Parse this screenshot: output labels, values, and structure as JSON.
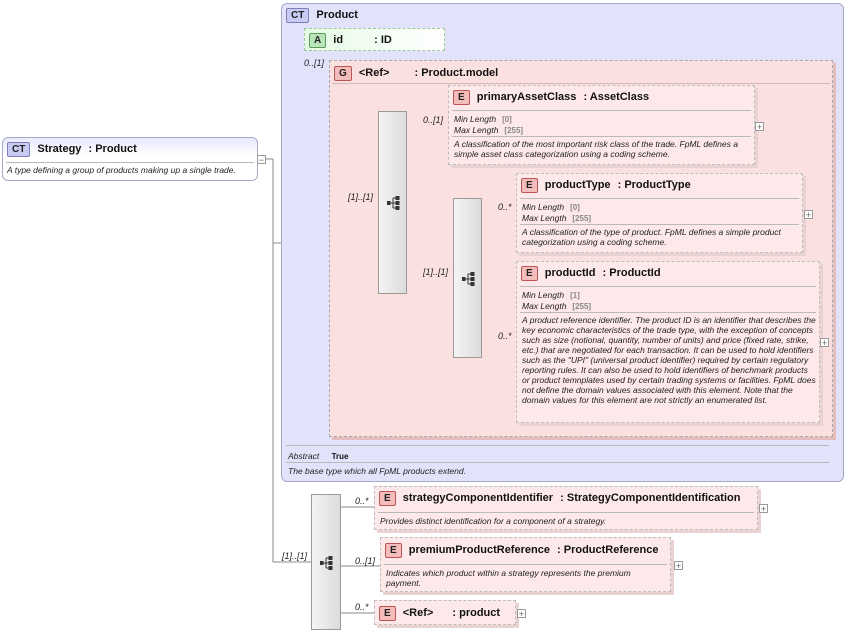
{
  "strategy": {
    "badge": "CT",
    "name": "Strategy",
    "type": ": Product",
    "doc": "A type defining a group of products making up a single trade."
  },
  "product": {
    "badge": "CT",
    "name": "Product",
    "abstract_label": "Abstract",
    "abstract_value": "True",
    "doc": "The base type which all FpML products extend.",
    "id_attr": {
      "badge": "A",
      "name": "id",
      "type": ": ID"
    },
    "id_cardinality": "0..[1]",
    "group": {
      "badge": "G",
      "name": "<Ref>",
      "type": ": Product.model",
      "seq_cardinality": "[1]..[1]"
    }
  },
  "primaryAssetClass": {
    "badge": "E",
    "name": "primaryAssetClass",
    "type": ": AssetClass",
    "cardinality": "0..[1]",
    "facets": [
      {
        "label": "Min Length",
        "value": "[0]"
      },
      {
        "label": "Max Length",
        "value": "[255]"
      }
    ],
    "doc": "A classification of the most important risk class of the trade. FpML defines a simple asset class categorization using a coding scheme."
  },
  "inner_seq_cardinality": "[1]..[1]",
  "productType": {
    "badge": "E",
    "name": "productType",
    "type": ": ProductType",
    "cardinality": "0..*",
    "facets": [
      {
        "label": "Min Length",
        "value": "[0]"
      },
      {
        "label": "Max Length",
        "value": "[255]"
      }
    ],
    "doc": "A classification of the type of product. FpML defines a simple product categorization using a coding scheme."
  },
  "productId": {
    "badge": "E",
    "name": "productId",
    "type": ": ProductId",
    "cardinality": "0..*",
    "facets": [
      {
        "label": "Min Length",
        "value": "[1]"
      },
      {
        "label": "Max Length",
        "value": "[255]"
      }
    ],
    "doc": "A product reference identifier. The product ID is an identifier that describes the key economic characteristics of the trade type, with the exception of concepts such as size (notional, quantity, number of units) and price (fixed rate, strike, etc.) that are negotiated for each transaction. It can be used to hold identifiers such as the \"UPI\" (universal product identifier) required by certain regulatory reporting rules. It can also be used to hold identifiers of benchmark products or product temnplates used by certain trading systems or facilities. FpML does not define the domain values associated with this element. Note that the domain values for this element are not strictly an enumerated list."
  },
  "bottom_seq_cardinality": "[1]..[1]",
  "strategyComponentIdentifier": {
    "badge": "E",
    "name": "strategyComponentIdentifier",
    "type": ": StrategyComponentIdentification",
    "cardinality": "0..*",
    "doc": "Provides distinct identification for a component of a strategy."
  },
  "premiumProductReference": {
    "badge": "E",
    "name": "premiumProductReference",
    "type": ": ProductReference",
    "cardinality": "0..[1]",
    "doc": "Indicates which product within a strategy represents the premium payment."
  },
  "productRef": {
    "badge": "E",
    "name": "<Ref>",
    "type": ": product",
    "cardinality": "0..*"
  },
  "colors": {
    "element_fill": "#fde9e9",
    "group_fill": "#fbe0e0",
    "complex_type_fill": "#e2e3fb",
    "attribute_fill": "#e6fbe6"
  }
}
